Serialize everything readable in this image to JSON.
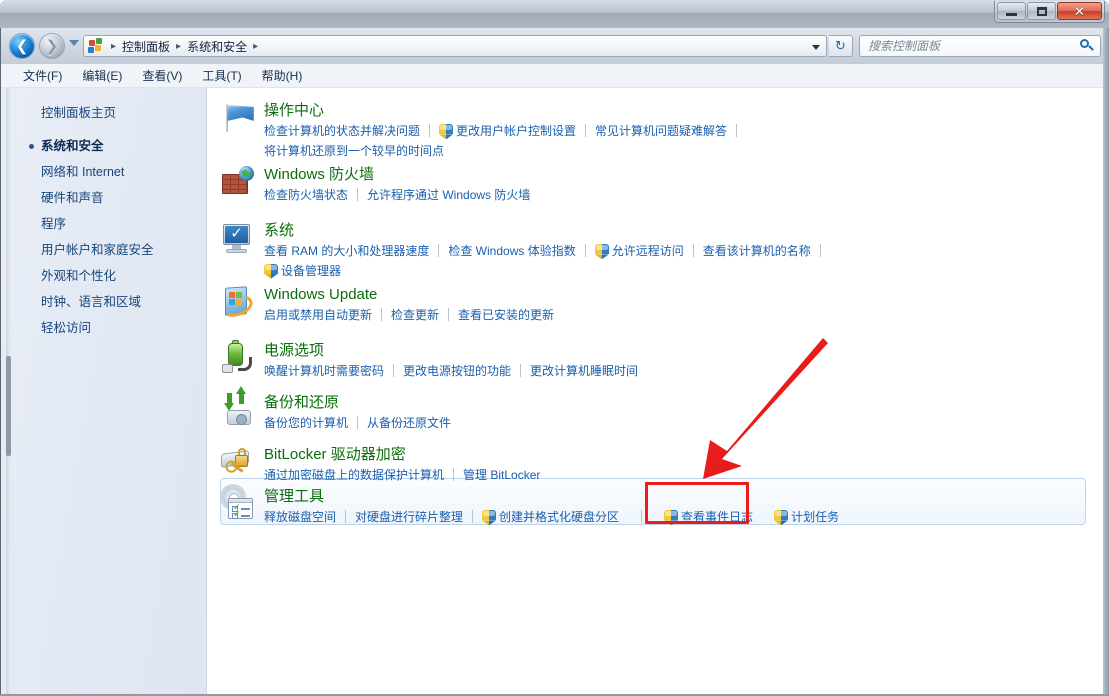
{
  "window": {
    "minimize_label": "最小化",
    "maximize_label": "最大化",
    "close_label": "关闭"
  },
  "nav": {
    "back_label": "后退",
    "forward_label": "前进",
    "history_label": "最近浏览的位置",
    "refresh_label": "刷新",
    "breadcrumbs": [
      "控制面板",
      "系统和安全"
    ],
    "breadcrumb_sep": "▸"
  },
  "search": {
    "placeholder": "搜索控制面板",
    "value": ""
  },
  "menubar": {
    "items": [
      "文件(F)",
      "编辑(E)",
      "查看(V)",
      "工具(T)",
      "帮助(H)"
    ]
  },
  "sidebar": {
    "home_label": "控制面板主页",
    "items": [
      {
        "label": "系统和安全",
        "current": true
      },
      {
        "label": "网络和 Internet",
        "current": false
      },
      {
        "label": "硬件和声音",
        "current": false
      },
      {
        "label": "程序",
        "current": false
      },
      {
        "label": "用户帐户和家庭安全",
        "current": false
      },
      {
        "label": "外观和个性化",
        "current": false
      },
      {
        "label": "时钟、语言和区域",
        "current": false
      },
      {
        "label": "轻松访问",
        "current": false
      }
    ]
  },
  "categories": [
    {
      "id": "action-center",
      "icon": "flag-icon",
      "title": "操作中心",
      "links_row1": [
        {
          "text": "检查计算机的状态并解决问题",
          "shield": false
        },
        {
          "text": "更改用户帐户控制设置",
          "shield": true
        },
        {
          "text": "常见计算机问题疑难解答",
          "shield": false
        }
      ],
      "links_row2": [
        {
          "text": "将计算机还原到一个较早的时间点",
          "shield": false
        }
      ]
    },
    {
      "id": "windows-firewall",
      "icon": "firewall-icon",
      "title": "Windows 防火墙",
      "links_row1": [
        {
          "text": "检查防火墙状态",
          "shield": false
        },
        {
          "text": "允许程序通过 Windows 防火墙",
          "shield": false
        }
      ],
      "links_row2": []
    },
    {
      "id": "system",
      "icon": "system-icon",
      "title": "系统",
      "links_row1": [
        {
          "text": "查看 RAM 的大小和处理器速度",
          "shield": false
        },
        {
          "text": "检查 Windows 体验指数",
          "shield": false
        },
        {
          "text": "允许远程访问",
          "shield": true
        },
        {
          "text": "查看该计算机的名称",
          "shield": false
        }
      ],
      "links_row2": [
        {
          "text": "设备管理器",
          "shield": true
        }
      ]
    },
    {
      "id": "windows-update",
      "icon": "update-icon",
      "title": "Windows Update",
      "links_row1": [
        {
          "text": "启用或禁用自动更新",
          "shield": false
        },
        {
          "text": "检查更新",
          "shield": false
        },
        {
          "text": "查看已安装的更新",
          "shield": false
        }
      ],
      "links_row2": []
    },
    {
      "id": "power-options",
      "icon": "battery-icon",
      "title": "电源选项",
      "links_row1": [
        {
          "text": "唤醒计算机时需要密码",
          "shield": false
        },
        {
          "text": "更改电源按钮的功能",
          "shield": false
        },
        {
          "text": "更改计算机睡眠时间",
          "shield": false
        }
      ],
      "links_row2": []
    },
    {
      "id": "backup-restore",
      "icon": "backup-icon",
      "title": "备份和还原",
      "links_row1": [
        {
          "text": "备份您的计算机",
          "shield": false
        },
        {
          "text": "从备份还原文件",
          "shield": false
        }
      ],
      "links_row2": []
    },
    {
      "id": "bitlocker",
      "icon": "lock-key-icon",
      "title": "BitLocker 驱动器加密",
      "links_row1": [
        {
          "text": "通过加密磁盘上的数据保护计算机",
          "shield": false
        },
        {
          "text": "管理 BitLocker",
          "shield": false
        }
      ],
      "links_row2": []
    },
    {
      "id": "admin-tools",
      "icon": "admin-tools-icon",
      "title": "管理工具",
      "links_row1": [
        {
          "text": "释放磁盘空间",
          "shield": false
        },
        {
          "text": "对硬盘进行碎片整理",
          "shield": false
        },
        {
          "text": "创建并格式化硬盘分区",
          "shield": true
        },
        {
          "text": "查看事件日志",
          "shield": true
        },
        {
          "text": "计划任务",
          "shield": true
        }
      ],
      "links_row2": []
    }
  ],
  "annotations": {
    "highlight_color": "#ef1b1b",
    "highlight_target": "查看事件日志",
    "arrow_color": "#ee2222"
  },
  "colors": {
    "category_title": "#0b6d0b",
    "link": "#1a5fae",
    "sidebar_link": "#17457c",
    "accent": "#ef1b1b"
  }
}
